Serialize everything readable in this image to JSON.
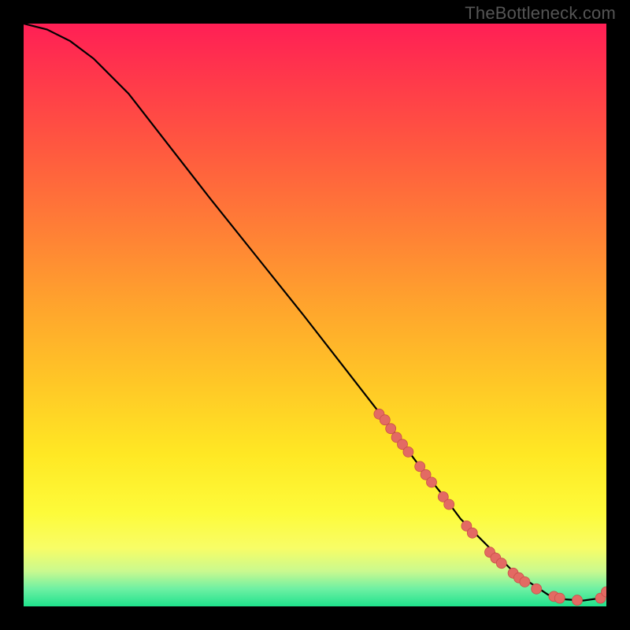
{
  "watermark": "TheBottleneck.com",
  "chart_data": {
    "type": "line",
    "title": "",
    "xlabel": "",
    "ylabel": "",
    "xlim": [
      0,
      100
    ],
    "ylim": [
      0,
      100
    ],
    "grid": false,
    "series": [
      {
        "name": "bottleneck-curve",
        "x": [
          0,
          4,
          8,
          12,
          18,
          25,
          32,
          40,
          48,
          55,
          62,
          68,
          72,
          75,
          78,
          81,
          84,
          87,
          90,
          93,
          96,
          99,
          100
        ],
        "y": [
          100,
          99,
          97,
          94,
          88,
          79,
          70,
          60,
          50,
          41,
          32,
          24,
          19,
          15,
          12,
          9,
          6,
          4,
          2,
          1.2,
          1,
          1.4,
          2.5
        ]
      }
    ],
    "markers": {
      "name": "highlighted-points",
      "x": [
        61,
        62,
        63,
        64,
        65,
        66,
        68,
        69,
        70,
        72,
        73,
        76,
        77,
        80,
        81,
        82,
        84,
        85,
        86,
        88,
        91,
        92,
        95,
        99,
        100
      ],
      "y": [
        33,
        32,
        30.5,
        29,
        27.8,
        26.5,
        24,
        22.6,
        21.3,
        18.8,
        17.5,
        13.8,
        12.6,
        9.3,
        8.3,
        7.4,
        5.7,
        4.9,
        4.2,
        3,
        1.7,
        1.4,
        1.05,
        1.4,
        2.5
      ]
    },
    "background": {
      "type": "vertical-gradient",
      "stops": [
        {
          "pos": 0,
          "color": "#ff1f55"
        },
        {
          "pos": 35,
          "color": "#ff7e36"
        },
        {
          "pos": 62,
          "color": "#ffc826"
        },
        {
          "pos": 84,
          "color": "#fdfb3a"
        },
        {
          "pos": 97,
          "color": "#6ef0a3"
        },
        {
          "pos": 100,
          "color": "#1fe28c"
        }
      ]
    }
  }
}
